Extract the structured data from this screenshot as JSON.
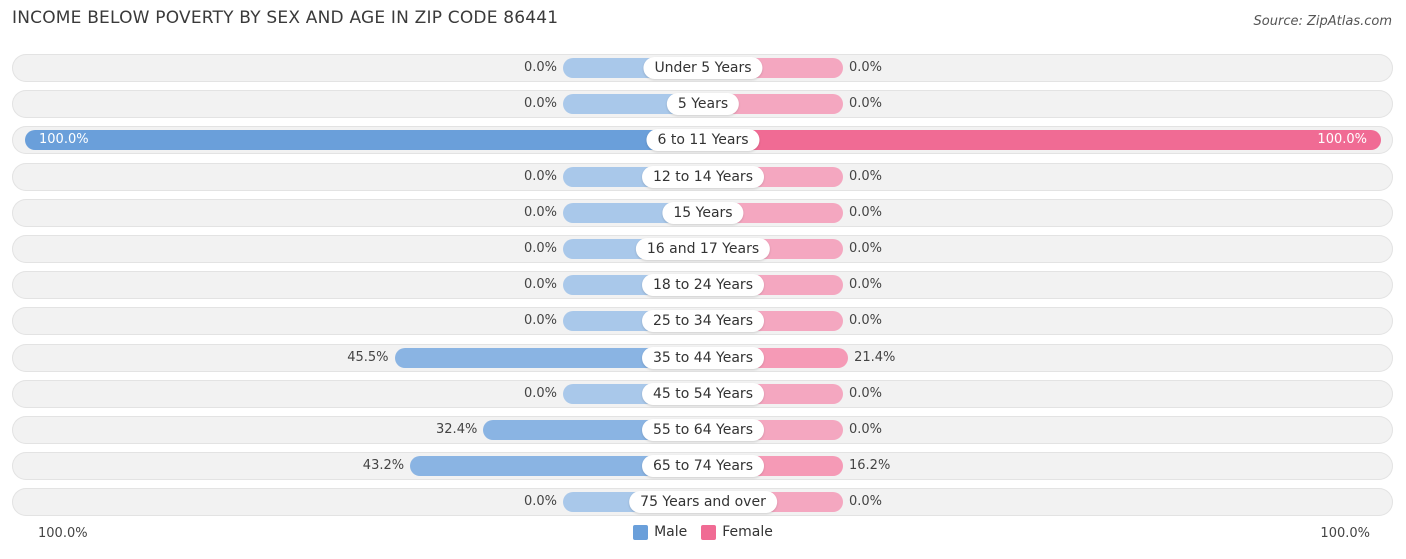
{
  "chart_data": {
    "type": "bar",
    "orientation": "horizontal-diverging",
    "title": "INCOME BELOW POVERTY BY SEX AND AGE IN ZIP CODE 86441",
    "source": "Source: ZipAtlas.com",
    "categories": [
      "Under 5 Years",
      "5 Years",
      "6 to 11 Years",
      "12 to 14 Years",
      "15 Years",
      "16 and 17 Years",
      "18 to 24 Years",
      "25 to 34 Years",
      "35 to 44 Years",
      "45 to 54 Years",
      "55 to 64 Years",
      "65 to 74 Years",
      "75 Years and over"
    ],
    "series": [
      {
        "name": "Male",
        "color": "#6a9fda",
        "color_light": "#a9c8ea",
        "values": [
          0.0,
          0.0,
          100.0,
          0.0,
          0.0,
          0.0,
          0.0,
          0.0,
          45.5,
          0.0,
          32.4,
          43.2,
          0.0
        ]
      },
      {
        "name": "Female",
        "color": "#f06b94",
        "color_light": "#f4a7c0",
        "values": [
          0.0,
          0.0,
          100.0,
          0.0,
          0.0,
          0.0,
          0.0,
          0.0,
          21.4,
          0.0,
          0.0,
          16.2,
          0.0
        ]
      }
    ],
    "xlim": [
      0,
      100
    ],
    "axis_left_label": "100.0%",
    "axis_right_label": "100.0%",
    "legend_position": "bottom-center",
    "value_format": "{v}%"
  }
}
